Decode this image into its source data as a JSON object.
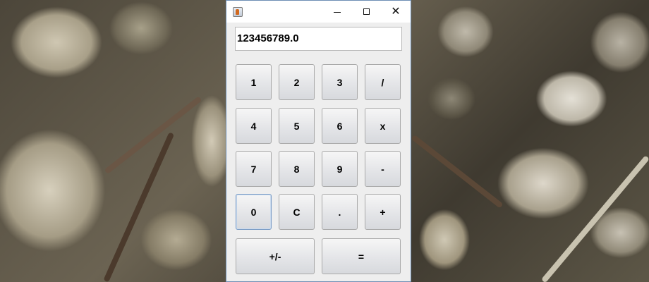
{
  "window": {
    "title": "",
    "controls": {
      "minimize_icon": "minimize-icon",
      "maximize_icon": "maximize-icon",
      "close_label": "✕"
    }
  },
  "display": {
    "value": "123456789.0"
  },
  "keypad": {
    "rows": [
      [
        "1",
        "2",
        "3",
        "/"
      ],
      [
        "4",
        "5",
        "6",
        "x"
      ],
      [
        "7",
        "8",
        "9",
        "-"
      ],
      [
        "0",
        "C",
        ".",
        "+"
      ]
    ],
    "bottom": {
      "sign": "+/-",
      "equals": "="
    }
  },
  "colors": {
    "window_border": "#6e8fb5",
    "focus_border": "#7a9cc6",
    "background_desktop": "#6b6556"
  }
}
